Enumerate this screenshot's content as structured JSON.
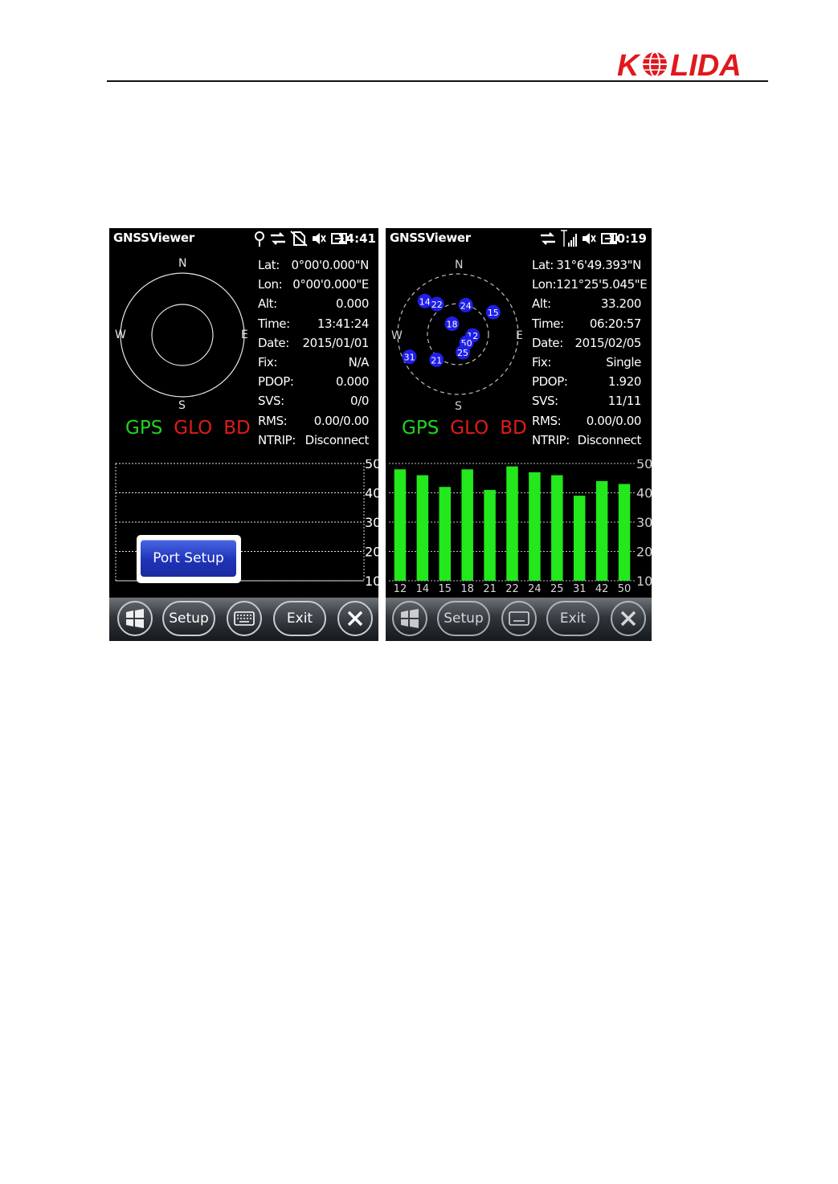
{
  "brand": {
    "logo_text": "KOLIDA"
  },
  "screens": [
    {
      "app_title": "GNSSViewer",
      "clock": "14:41",
      "status_icons": [
        "gps-pin-icon",
        "sync-arrows-icon",
        "no-sim-icon",
        "speaker-muted-icon",
        "battery-charging-icon"
      ],
      "compass": {
        "n": "N",
        "s": "S",
        "e": "E",
        "w": "W"
      },
      "systems": {
        "gps": "GPS",
        "glo": "GLO",
        "bd": "BD"
      },
      "info": [
        {
          "label": "Lat:",
          "value": "0°00'0.000\"N"
        },
        {
          "label": "Lon:",
          "value": "0°00'0.000\"E"
        },
        {
          "label": "Alt:",
          "value": "0.000"
        },
        {
          "label": "Time:",
          "value": "13:41:24"
        },
        {
          "label": "Date:",
          "value": "2015/01/01"
        },
        {
          "label": "Fix:",
          "value": "N/A"
        },
        {
          "label": "PDOP:",
          "value": "0.000"
        },
        {
          "label": "SVS:",
          "value": "0/0"
        },
        {
          "label": "RMS:",
          "value": "0.00/0.00"
        },
        {
          "label": "NTRIP:",
          "value": "Disconnect"
        }
      ],
      "satellites": [],
      "chart_data": {
        "type": "bar",
        "categories": [],
        "values": [],
        "ylim": [
          10,
          50
        ],
        "yticks": [
          "50",
          "40",
          "30",
          "20",
          "10"
        ]
      },
      "popup": {
        "port_setup_label": "Port Setup"
      },
      "taskbar": {
        "start_icon": "windows-start-icon",
        "setup_label": "Setup",
        "keyboard_icon": "keyboard-icon",
        "exit_label": "Exit",
        "close_icon": "close-icon"
      }
    },
    {
      "app_title": "GNSSViewer",
      "clock": "10:19",
      "status_icons": [
        "sync-arrows-icon",
        "signal-bars-icon",
        "speaker-muted-icon",
        "battery-charging-icon"
      ],
      "compass": {
        "n": "N",
        "s": "S",
        "e": "E",
        "w": "W"
      },
      "systems": {
        "gps": "GPS",
        "glo": "GLO",
        "bd": "BD"
      },
      "info": [
        {
          "label": "Lat:",
          "value": "31°6'49.393\"N"
        },
        {
          "label": "Lon:",
          "value": "121°25'5.045\"E"
        },
        {
          "label": "Alt:",
          "value": "33.200"
        },
        {
          "label": "Time:",
          "value": "06:20:57"
        },
        {
          "label": "Date:",
          "value": "2015/02/05"
        },
        {
          "label": "Fix:",
          "value": "Single"
        },
        {
          "label": "PDOP:",
          "value": "1.920"
        },
        {
          "label": "SVS:",
          "value": "11/11"
        },
        {
          "label": "RMS:",
          "value": "0.00/0.00"
        },
        {
          "label": "NTRIP:",
          "value": "Disconnect"
        }
      ],
      "satellites": [
        {
          "id": "14",
          "az": 315,
          "el": 20
        },
        {
          "id": "22",
          "az": 325,
          "el": 35
        },
        {
          "id": "24",
          "az": 15,
          "el": 45
        },
        {
          "id": "15",
          "az": 58,
          "el": 28
        },
        {
          "id": "18",
          "az": 330,
          "el": 72
        },
        {
          "id": "12",
          "az": 95,
          "el": 68
        },
        {
          "id": "50",
          "az": 135,
          "el": 72
        },
        {
          "id": "25",
          "az": 165,
          "el": 62
        },
        {
          "id": "31",
          "az": 245,
          "el": 10
        },
        {
          "id": "21",
          "az": 220,
          "el": 40
        }
      ],
      "chart_data": {
        "type": "bar",
        "categories": [
          "12",
          "14",
          "15",
          "18",
          "21",
          "22",
          "24",
          "25",
          "31",
          "42",
          "50"
        ],
        "values": [
          48,
          46,
          42,
          48,
          41,
          49,
          47,
          46,
          39,
          44,
          43
        ],
        "ylim": [
          10,
          50
        ],
        "yticks": [
          "50",
          "40",
          "30",
          "20",
          "10"
        ]
      },
      "taskbar": {
        "start_icon": "windows-start-icon",
        "setup_label": "Setup",
        "keyboard_icon": "keyboard-icon",
        "exit_label": "Exit",
        "close_icon": "close-icon"
      }
    }
  ]
}
